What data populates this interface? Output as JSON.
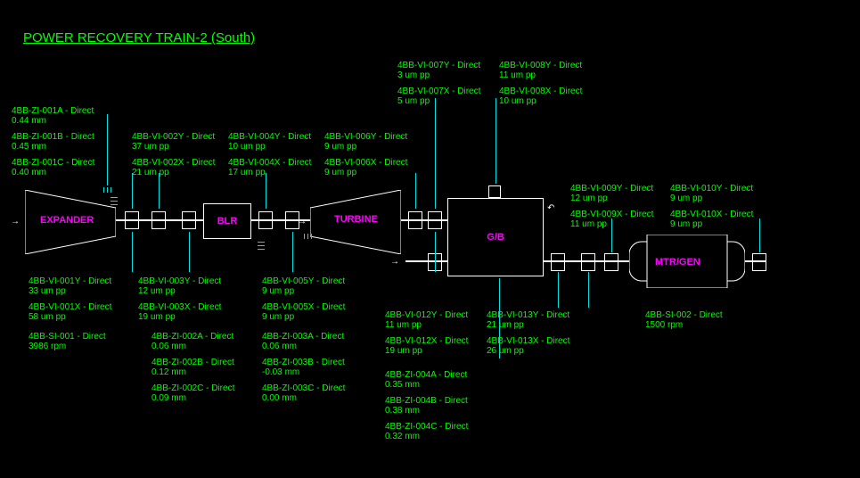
{
  "title": "POWER RECOVERY TRAIN-2 (South)",
  "equipment": {
    "expander": "EXPANDER",
    "blr": "BLR",
    "turbine": "TURBINE",
    "gb": "G/B",
    "mtrgen": "MTR/GEN"
  },
  "sensors": {
    "zi001a": {
      "label": "4BB-ZI-001A - Direct",
      "value": "0.44 mm"
    },
    "zi001b": {
      "label": "4BB-ZI-001B - Direct",
      "value": "0.45 mm"
    },
    "zi001c": {
      "label": "4BB-ZI-001C - Direct",
      "value": "0.40 mm"
    },
    "vi002y": {
      "label": "4BB-VI-002Y - Direct",
      "value": "37 um pp"
    },
    "vi002x": {
      "label": "4BB-VI-002X - Direct",
      "value": "21 um pp"
    },
    "vi004y": {
      "label": "4BB-VI-004Y - Direct",
      "value": "10 um pp"
    },
    "vi004x": {
      "label": "4BB-VI-004X - Direct",
      "value": "17 um pp"
    },
    "vi006y": {
      "label": "4BB-VI-006Y - Direct",
      "value": "9 um pp"
    },
    "vi006x": {
      "label": "4BB-VI-006X - Direct",
      "value": "9 um pp"
    },
    "vi007y": {
      "label": "4BB-VI-007Y - Direct",
      "value": "3 um pp"
    },
    "vi007x": {
      "label": "4BB-VI-007X - Direct",
      "value": "5 um pp"
    },
    "vi008y": {
      "label": "4BB-VI-008Y - Direct",
      "value": "11 um pp"
    },
    "vi008x": {
      "label": "4BB-VI-008X - Direct",
      "value": "10 um pp"
    },
    "vi009y": {
      "label": "4BB-VI-009Y - Direct",
      "value": "12 um pp"
    },
    "vi009x": {
      "label": "4BB-VI-009X - Direct",
      "value": "11 um pp"
    },
    "vi010y": {
      "label": "4BB-VI-010Y - Direct",
      "value": "9 um pp"
    },
    "vi010x": {
      "label": "4BB-VI-010X - Direct",
      "value": "9 um pp"
    },
    "vi001y": {
      "label": "4BB-VI-001Y - Direct",
      "value": "33 um pp"
    },
    "vi001x": {
      "label": "4BB-VI-001X - Direct",
      "value": "58 um pp"
    },
    "si001": {
      "label": "4BB-SI-001 - Direct",
      "value": "3986 rpm"
    },
    "vi003y": {
      "label": "4BB-VI-003Y - Direct",
      "value": "12 um pp"
    },
    "vi003x": {
      "label": "4BB-VI-003X - Direct",
      "value": "19 um pp"
    },
    "zi002a": {
      "label": "4BB-ZI-002A - Direct",
      "value": "0.06 mm"
    },
    "zi002b": {
      "label": "4BB-ZI-002B - Direct",
      "value": "0.12 mm"
    },
    "zi002c": {
      "label": "4BB-ZI-002C - Direct",
      "value": "0.09 mm"
    },
    "vi005y": {
      "label": "4BB-VI-005Y - Direct",
      "value": "9 um pp"
    },
    "vi005x": {
      "label": "4BB-VI-005X - Direct",
      "value": "9 um pp"
    },
    "zi003a": {
      "label": "4BB-ZI-003A - Direct",
      "value": "0.06 mm"
    },
    "zi003b": {
      "label": "4BB-ZI-003B - Direct",
      "value": "-0.03 mm"
    },
    "zi003c": {
      "label": "4BB-ZI-003C - Direct",
      "value": "0.00 mm"
    },
    "vi012y": {
      "label": "4BB-VI-012Y - Direct",
      "value": "11 um pp"
    },
    "vi012x": {
      "label": "4BB-VI-012X - Direct",
      "value": "19 um pp"
    },
    "zi004a": {
      "label": "4BB-ZI-004A - Direct",
      "value": "0.35 mm"
    },
    "zi004b": {
      "label": "4BB-ZI-004B - Direct",
      "value": "0.38 mm"
    },
    "zi004c": {
      "label": "4BB-ZI-004C - Direct",
      "value": "0.32 mm"
    },
    "vi013y": {
      "label": "4BB-VI-013Y - Direct",
      "value": "21 um pp"
    },
    "vi013x": {
      "label": "4BB-VI-013X - Direct",
      "value": "26 um pp"
    },
    "si002": {
      "label": "4BB-SI-002 - Direct",
      "value": "1500 rpm"
    }
  },
  "chart_data": {
    "type": "table",
    "title": "POWER RECOVERY TRAIN-2 (South) — sensor readings",
    "equipment_chain": [
      "EXPANDER",
      "BLR",
      "TURBINE",
      "G/B",
      "MTR/GEN"
    ],
    "rows": [
      {
        "tag": "4BB-ZI-001A",
        "mode": "Direct",
        "value": 0.44,
        "unit": "mm"
      },
      {
        "tag": "4BB-ZI-001B",
        "mode": "Direct",
        "value": 0.45,
        "unit": "mm"
      },
      {
        "tag": "4BB-ZI-001C",
        "mode": "Direct",
        "value": 0.4,
        "unit": "mm"
      },
      {
        "tag": "4BB-VI-001Y",
        "mode": "Direct",
        "value": 33,
        "unit": "um pp"
      },
      {
        "tag": "4BB-VI-001X",
        "mode": "Direct",
        "value": 58,
        "unit": "um pp"
      },
      {
        "tag": "4BB-SI-001",
        "mode": "Direct",
        "value": 3986,
        "unit": "rpm"
      },
      {
        "tag": "4BB-VI-002Y",
        "mode": "Direct",
        "value": 37,
        "unit": "um pp"
      },
      {
        "tag": "4BB-VI-002X",
        "mode": "Direct",
        "value": 21,
        "unit": "um pp"
      },
      {
        "tag": "4BB-VI-003Y",
        "mode": "Direct",
        "value": 12,
        "unit": "um pp"
      },
      {
        "tag": "4BB-VI-003X",
        "mode": "Direct",
        "value": 19,
        "unit": "um pp"
      },
      {
        "tag": "4BB-ZI-002A",
        "mode": "Direct",
        "value": 0.06,
        "unit": "mm"
      },
      {
        "tag": "4BB-ZI-002B",
        "mode": "Direct",
        "value": 0.12,
        "unit": "mm"
      },
      {
        "tag": "4BB-ZI-002C",
        "mode": "Direct",
        "value": 0.09,
        "unit": "mm"
      },
      {
        "tag": "4BB-VI-004Y",
        "mode": "Direct",
        "value": 10,
        "unit": "um pp"
      },
      {
        "tag": "4BB-VI-004X",
        "mode": "Direct",
        "value": 17,
        "unit": "um pp"
      },
      {
        "tag": "4BB-VI-005Y",
        "mode": "Direct",
        "value": 9,
        "unit": "um pp"
      },
      {
        "tag": "4BB-VI-005X",
        "mode": "Direct",
        "value": 9,
        "unit": "um pp"
      },
      {
        "tag": "4BB-ZI-003A",
        "mode": "Direct",
        "value": 0.06,
        "unit": "mm"
      },
      {
        "tag": "4BB-ZI-003B",
        "mode": "Direct",
        "value": -0.03,
        "unit": "mm"
      },
      {
        "tag": "4BB-ZI-003C",
        "mode": "Direct",
        "value": 0.0,
        "unit": "mm"
      },
      {
        "tag": "4BB-VI-006Y",
        "mode": "Direct",
        "value": 9,
        "unit": "um pp"
      },
      {
        "tag": "4BB-VI-006X",
        "mode": "Direct",
        "value": 9,
        "unit": "um pp"
      },
      {
        "tag": "4BB-VI-007Y",
        "mode": "Direct",
        "value": 3,
        "unit": "um pp"
      },
      {
        "tag": "4BB-VI-007X",
        "mode": "Direct",
        "value": 5,
        "unit": "um pp"
      },
      {
        "tag": "4BB-VI-008Y",
        "mode": "Direct",
        "value": 11,
        "unit": "um pp"
      },
      {
        "tag": "4BB-VI-008X",
        "mode": "Direct",
        "value": 10,
        "unit": "um pp"
      },
      {
        "tag": "4BB-VI-012Y",
        "mode": "Direct",
        "value": 11,
        "unit": "um pp"
      },
      {
        "tag": "4BB-VI-012X",
        "mode": "Direct",
        "value": 19,
        "unit": "um pp"
      },
      {
        "tag": "4BB-VI-013Y",
        "mode": "Direct",
        "value": 21,
        "unit": "um pp"
      },
      {
        "tag": "4BB-VI-013X",
        "mode": "Direct",
        "value": 26,
        "unit": "um pp"
      },
      {
        "tag": "4BB-ZI-004A",
        "mode": "Direct",
        "value": 0.35,
        "unit": "mm"
      },
      {
        "tag": "4BB-ZI-004B",
        "mode": "Direct",
        "value": 0.38,
        "unit": "mm"
      },
      {
        "tag": "4BB-ZI-004C",
        "mode": "Direct",
        "value": 0.32,
        "unit": "mm"
      },
      {
        "tag": "4BB-VI-009Y",
        "mode": "Direct",
        "value": 12,
        "unit": "um pp"
      },
      {
        "tag": "4BB-VI-009X",
        "mode": "Direct",
        "value": 11,
        "unit": "um pp"
      },
      {
        "tag": "4BB-VI-010Y",
        "mode": "Direct",
        "value": 9,
        "unit": "um pp"
      },
      {
        "tag": "4BB-VI-010X",
        "mode": "Direct",
        "value": 9,
        "unit": "um pp"
      },
      {
        "tag": "4BB-SI-002",
        "mode": "Direct",
        "value": 1500,
        "unit": "rpm"
      }
    ]
  }
}
